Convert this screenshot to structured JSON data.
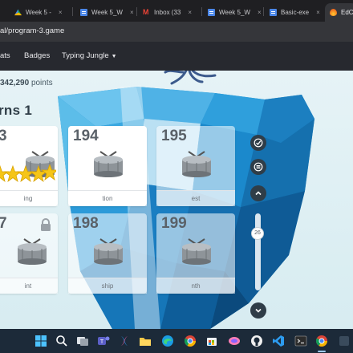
{
  "browser": {
    "tabs": [
      {
        "label": "Week 5 -",
        "icon": "drive-icon"
      },
      {
        "label": "Week 5_W",
        "icon": "docs-icon"
      },
      {
        "label": "Inbox (33",
        "icon": "gmail-icon"
      },
      {
        "label": "Week 5_W",
        "icon": "docs-icon"
      },
      {
        "label": "Basic-exe",
        "icon": "docs-icon"
      },
      {
        "label": "EdCl",
        "icon": "edclub-icon"
      }
    ],
    "close_glyph": "×",
    "url": "al/program-3.game"
  },
  "site_nav": {
    "items": [
      "ats",
      "Badges"
    ],
    "dropdown_label": "Typing Jungle"
  },
  "game": {
    "points_value": "342,290",
    "points_label": "points",
    "level_title": "rns 1",
    "lessons": [
      {
        "number": "3",
        "label": "ing",
        "stars": 5,
        "locked": false,
        "solid": true
      },
      {
        "number": "194",
        "label": "tion",
        "stars": 0,
        "locked": false,
        "solid": true
      },
      {
        "number": "195",
        "label": "est",
        "stars": 0,
        "locked": false,
        "solid": false
      },
      {
        "number": "7",
        "label": "int",
        "stars": 0,
        "locked": true,
        "solid": false
      },
      {
        "number": "198",
        "label": "ship",
        "stars": 0,
        "locked": false,
        "solid": false
      },
      {
        "number": "199",
        "label": "nth",
        "stars": 0,
        "locked": false,
        "solid": false
      }
    ],
    "controls": {
      "slider_value": "26"
    },
    "colors": {
      "accent_dark": "#2f3d48",
      "star_gold": "#f5c518",
      "ice_blue": "#1e88c8"
    }
  },
  "taskbar": {
    "icons": [
      "windows-start-icon",
      "search-icon",
      "task-view-icon",
      "teams-icon",
      "copilot-icon",
      "file-explorer-icon",
      "edge-icon",
      "chrome-icon",
      "store-icon",
      "colorful-app-icon",
      "github-icon",
      "vscode-icon",
      "terminal-icon",
      "chrome-profile-icon",
      "taskbar-app-icon"
    ]
  }
}
